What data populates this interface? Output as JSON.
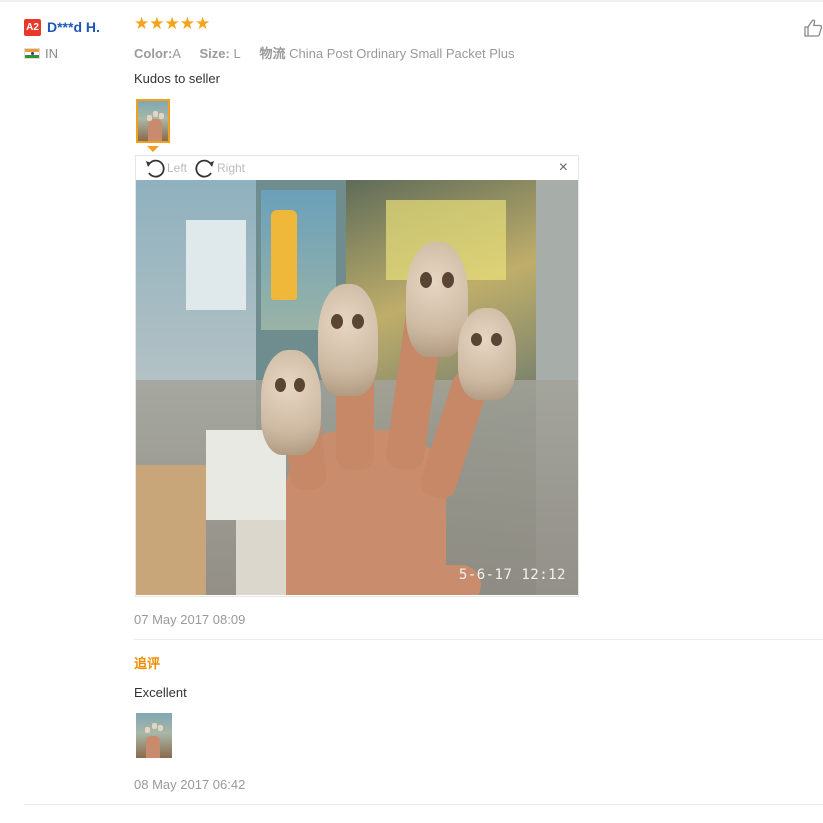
{
  "review": {
    "user": {
      "badge": "A2",
      "name": "D***d H.",
      "country_code": "IN"
    },
    "rating": {
      "stars": 5,
      "max": 5,
      "stars_text": "★★★★★"
    },
    "meta": {
      "color_label": "Color:",
      "color_value": "A",
      "size_label": "Size:",
      "size_value": "L",
      "shipping_label": "物流",
      "shipping_value": "China Post Ordinary Small Packet Plus"
    },
    "text": "Kudos to seller",
    "viewer": {
      "rotate_left_label": "Left",
      "rotate_right_label": "Right",
      "close_label": "×",
      "photo_timestamp": "5-6-17  12:12"
    },
    "date": "07 May 2017 08:09",
    "followup": {
      "title": "追评",
      "text": "Excellent",
      "date": "08 May 2017 06:42"
    }
  },
  "colors": {
    "star": "#f7a21b",
    "username": "#1d58b8",
    "badge": "#e7382c",
    "followup_title": "#f08c00",
    "active_thumb_border": "#f0a020"
  },
  "icons": [
    "thumbs-up-icon",
    "rotate-left-icon",
    "rotate-right-icon",
    "close-icon",
    "india-flag-icon"
  ]
}
